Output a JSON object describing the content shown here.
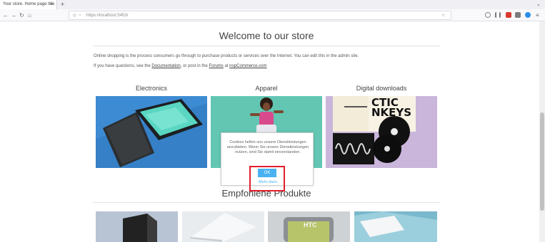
{
  "browser": {
    "tab_title": "Your store. Home page title",
    "tab_close": "×",
    "new_tab": "+",
    "tab_overflow": "⌄",
    "back": "←",
    "forward": "→",
    "reload": "↻",
    "home": "⌂",
    "url": "https://localhost:5453/",
    "menu": "≡"
  },
  "page": {
    "title": "Welcome to our store",
    "intro_line1": "Online shopping is the process consumers go through to purchase products or services over the Internet. You can edit this in the admin site.",
    "intro_prefix": "If you have questions, see the ",
    "documentation_link": "Documentation",
    "intro_middle": ", or post in the ",
    "forums_link": "Forums",
    "intro_at": " at ",
    "site_link": "nopCommerce.com",
    "categories": [
      {
        "label": "Electronics"
      },
      {
        "label": "Apparel"
      },
      {
        "label": "Digital downloads"
      }
    ],
    "album_text": "CTIC\nNKEYS",
    "featured_title": "Empfohlene Produkte",
    "product_badge": "HTC"
  },
  "cookie_dialog": {
    "message": "Cookies helfen uns unsere Dienstleistungen anzubieten. Wenn Sie unsere Dienstleistungen nutzen, sind Sie damit einverstanden.",
    "ok_label": "OK",
    "more_label": "Mehr dazu"
  },
  "colors": {
    "ok_button": "#4ab2f1",
    "highlight": "#e11d2a"
  }
}
